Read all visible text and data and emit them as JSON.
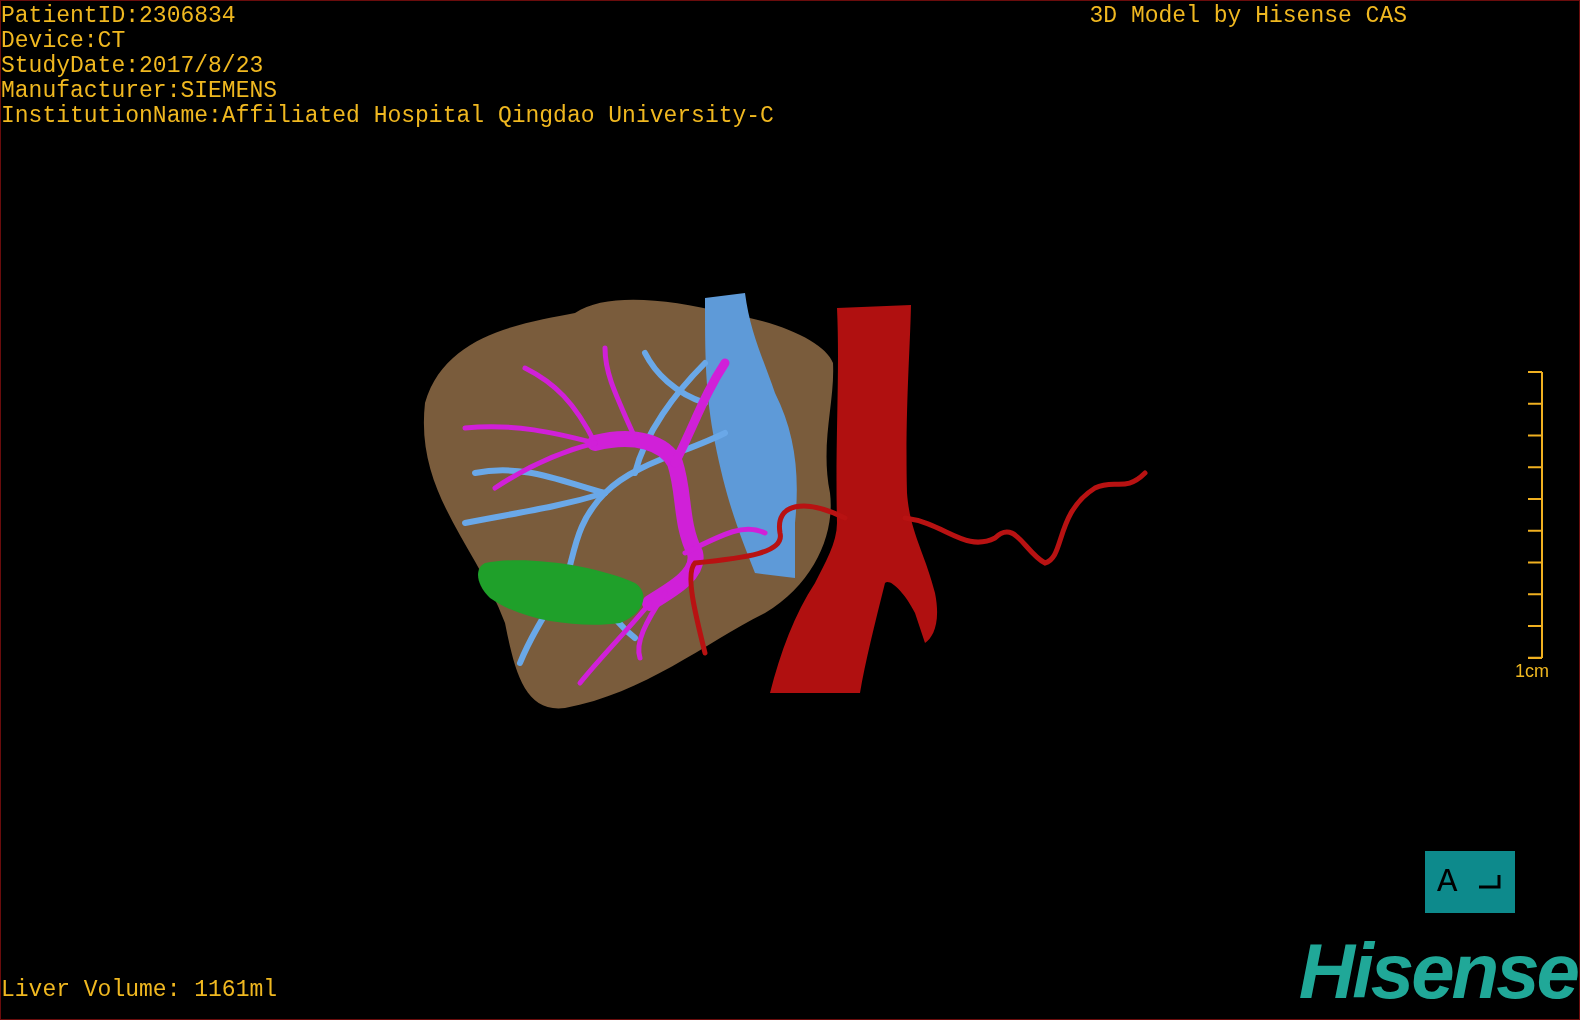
{
  "info_lines": [
    "PatientID:2306834",
    "Device:CT",
    "StudyDate:2017/8/23",
    "Manufacturer:SIEMENS",
    "InstitutionName:Affiliated Hospital Qingdao University-C"
  ],
  "model_credit": "3D Model by Hisense CAS",
  "scale_label": "1cm",
  "orientation_label": "A",
  "logo": "Hisense",
  "liver_volume": "Liver Volume: 1161ml"
}
